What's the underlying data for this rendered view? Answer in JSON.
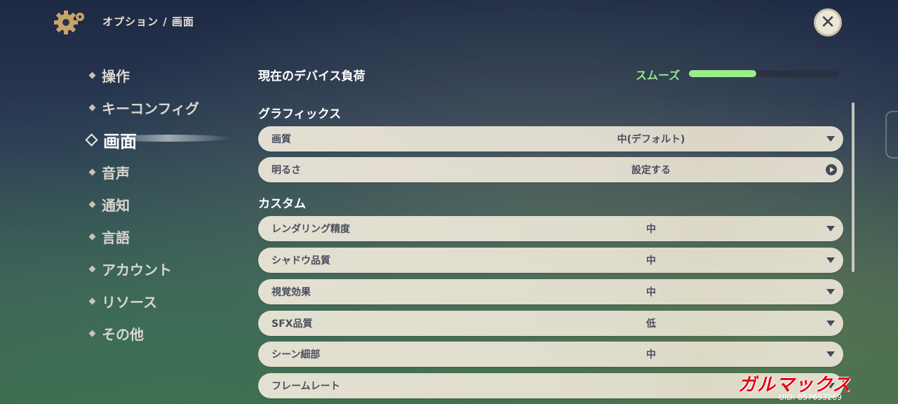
{
  "header": {
    "breadcrumb": "オプション / 画面",
    "close_icon": "close-icon",
    "settings_icon": "gear-icon"
  },
  "sidebar": {
    "items": [
      {
        "label": "操作",
        "active": false
      },
      {
        "label": "キーコンフィグ",
        "active": false
      },
      {
        "label": "画面",
        "active": true
      },
      {
        "label": "音声",
        "active": false
      },
      {
        "label": "通知",
        "active": false
      },
      {
        "label": "言語",
        "active": false
      },
      {
        "label": "アカウント",
        "active": false
      },
      {
        "label": "リソース",
        "active": false
      },
      {
        "label": "その他",
        "active": false
      }
    ]
  },
  "device_load": {
    "title": "現在のデバイス負荷",
    "status": "スムーズ",
    "level": 0.45,
    "status_color": "#8fe88a"
  },
  "graphics": {
    "title": "グラフィックス",
    "rows": [
      {
        "label": "画質",
        "value": "中(デフォルト)",
        "control": "dropdown"
      },
      {
        "label": "明るさ",
        "value": "設定する",
        "control": "navigate"
      }
    ]
  },
  "custom": {
    "title": "カスタム",
    "rows": [
      {
        "label": "レンダリング精度",
        "value": "中",
        "control": "dropdown"
      },
      {
        "label": "シャドウ品質",
        "value": "中",
        "control": "dropdown"
      },
      {
        "label": "視覚効果",
        "value": "中",
        "control": "dropdown"
      },
      {
        "label": "SFX品質",
        "value": "低",
        "control": "dropdown"
      },
      {
        "label": "シーン細部",
        "value": "中",
        "control": "dropdown"
      },
      {
        "label": "フレームレート",
        "value": "",
        "control": "dropdown"
      }
    ]
  },
  "footer": {
    "watermark": "ガルマックス",
    "uid": "UID: 857653269"
  }
}
